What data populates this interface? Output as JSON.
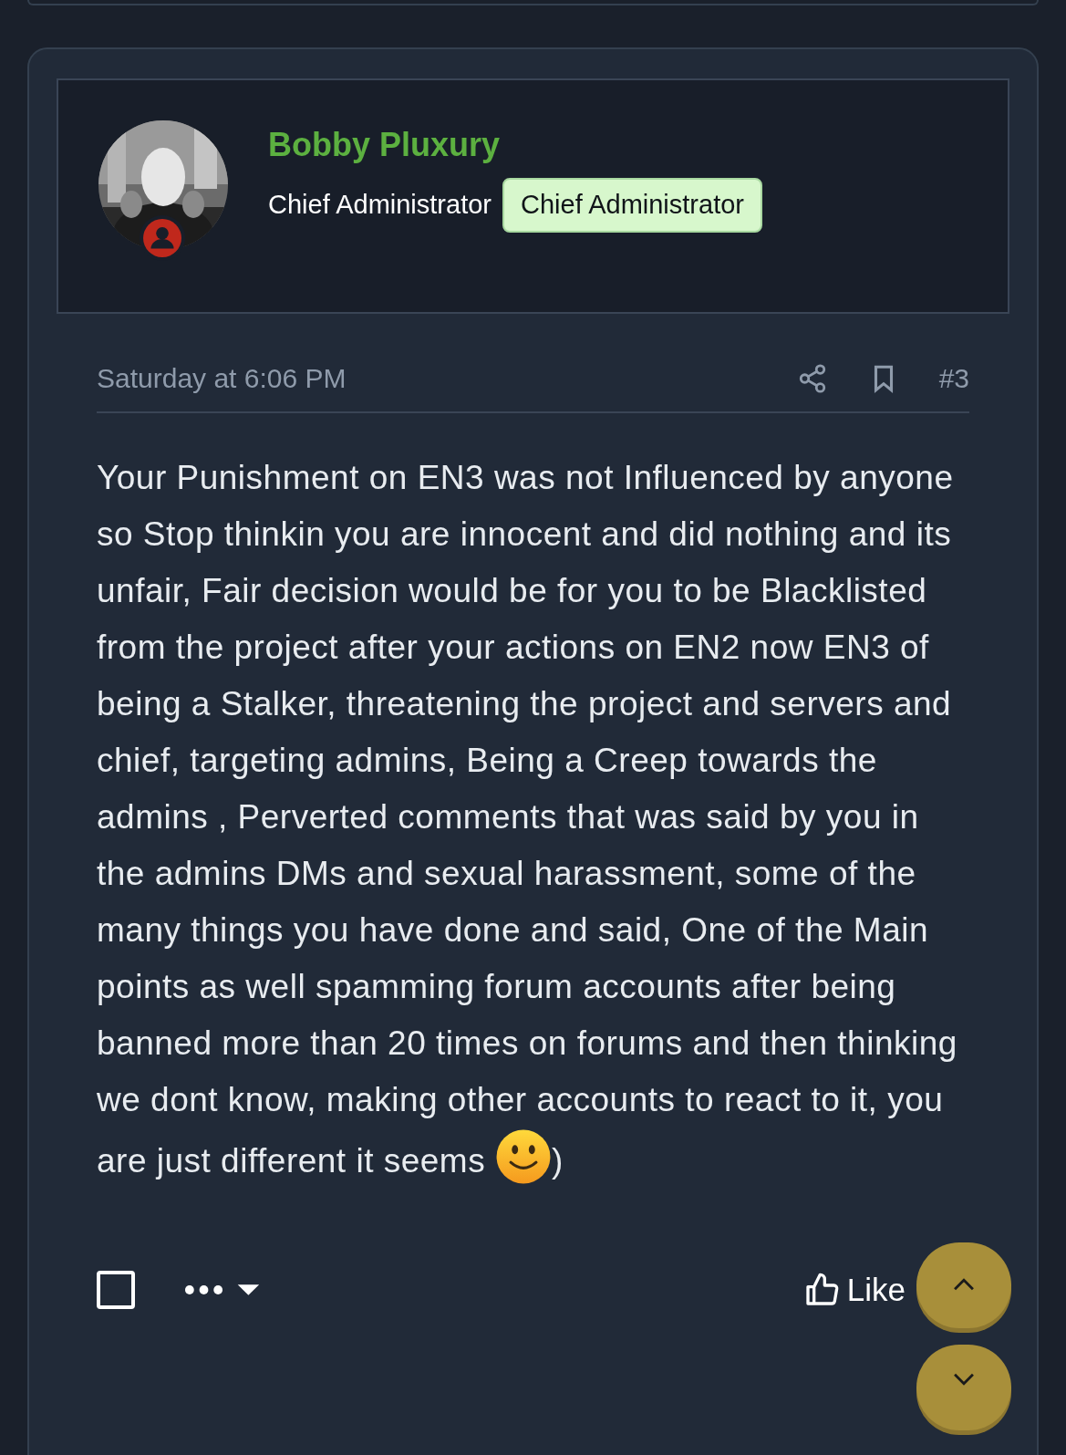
{
  "post": {
    "author": {
      "name": "Bobby Pluxury",
      "title": "Chief Administrator",
      "badge": "Chief Administrator"
    },
    "meta": {
      "time": "Saturday at 6:06 PM",
      "number": "#3"
    },
    "body": "Your Punishment on EN3 was not Influenced by anyone so Stop thinkin you are innocent and did nothing and its unfair, Fair decision would be for you to be Blacklisted from the project after your actions on EN2 now EN3 of being a Stalker, threatening the project and servers and chief, targeting admins, Being a Creep towards the admins , Perverted comments that was said by you in the admins DMs and sexual harassment, some of the many things you have done and said, One of the Main points as well spamming forum accounts after being banned more than 20 times on forums and then thinking we dont know, making other accounts to react to it, you are just different it seems",
    "body_suffix": ")",
    "footer": {
      "select": {
        "checked": false
      },
      "like": "Like"
    }
  }
}
